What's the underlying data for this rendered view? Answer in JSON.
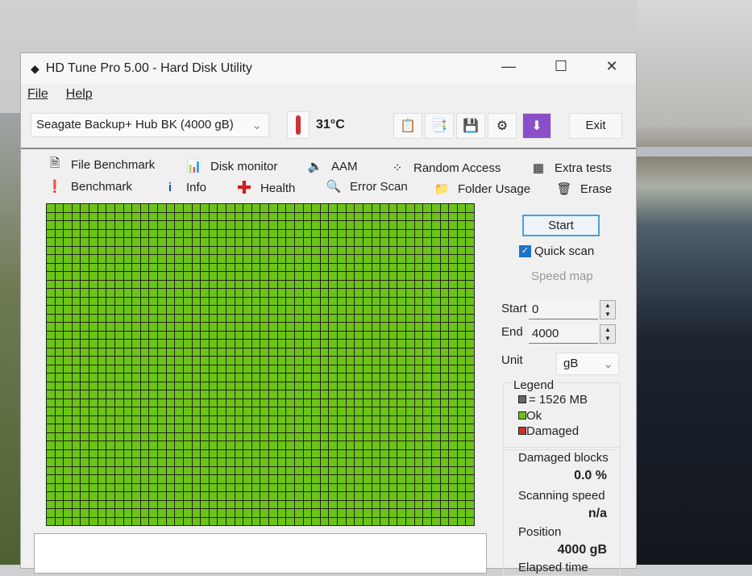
{
  "window": {
    "title": "HD Tune Pro 5.00 - Hard Disk Utility",
    "minimize": "—",
    "maximize": "☐",
    "close": "✕"
  },
  "menu": {
    "file": "File",
    "help": "Help"
  },
  "toolbar": {
    "drive": "Seagate Backup+ Hub BK  (4000 gB)",
    "temperature": "31°C",
    "exit": "Exit",
    "icons": [
      "copy-text-icon",
      "copy-screenshot-icon",
      "save-icon",
      "options-icon",
      "download-icon"
    ]
  },
  "tabs": {
    "row1": [
      "File Benchmark",
      "Disk monitor",
      "AAM",
      "Random Access",
      "Extra tests"
    ],
    "row2": [
      "Benchmark",
      "Info",
      "Health",
      "Error Scan",
      "Folder Usage",
      "Erase"
    ]
  },
  "scan": {
    "start_button": "Start",
    "quick_scan": "Quick scan",
    "quick_scan_checked": true,
    "speed_map": "Speed map",
    "start_label": "Start",
    "start_value": "0",
    "end_label": "End",
    "end_value": "4000",
    "unit_label": "Unit",
    "unit_value": "gB",
    "legend_title": "Legend",
    "legend_block": "= 1526 MB",
    "legend_ok": "Ok",
    "legend_damaged": "Damaged",
    "damaged_blocks_label": "Damaged blocks",
    "damaged_blocks_value": "0.0 %",
    "scanning_speed_label": "Scanning speed",
    "scanning_speed_value": "n/a",
    "position_label": "Position",
    "position_value": "4000 gB",
    "elapsed_label": "Elapsed time"
  },
  "colors": {
    "ok": "#6cc417",
    "damaged": "#d0302a",
    "block": "#666666"
  }
}
